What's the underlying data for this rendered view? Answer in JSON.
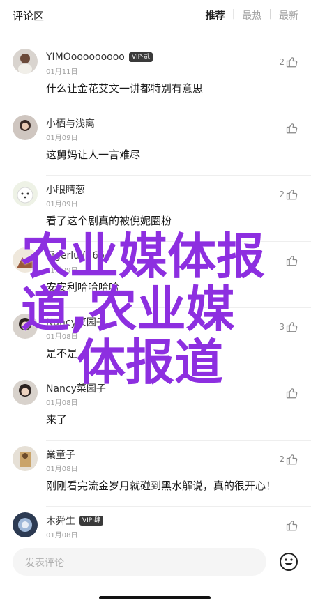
{
  "header": {
    "title": "评论区",
    "tabs": [
      {
        "label": "推荐",
        "active": true
      },
      {
        "label": "最热",
        "active": false
      },
      {
        "label": "最新",
        "active": false
      }
    ]
  },
  "comments": [
    {
      "name": "YIMOooooooooo",
      "badge": "VIP·贰",
      "date": "01月11日",
      "text": "什么让金花艾文一讲都特别有意思",
      "likes": "2"
    },
    {
      "name": "小栖与浅离",
      "badge": "",
      "date": "01月09日",
      "text": "这舅妈让人一言难尽",
      "likes": ""
    },
    {
      "name": "小眼睛葱",
      "badge": "",
      "date": "01月09日",
      "text": "看了这个剧真的被倪妮圈粉",
      "likes": "2"
    },
    {
      "name": "Tigerlul(366",
      "badge": "",
      "date": "01月09日",
      "text": "安安利哈哈哈哈",
      "likes": ""
    },
    {
      "name": "Nancy菜园子",
      "badge": "",
      "date": "01月08日",
      "text": "是不是",
      "likes": "3"
    },
    {
      "name": "Nancy菜园子",
      "badge": "",
      "date": "01月08日",
      "text": "来了",
      "likes": ""
    },
    {
      "name": "業童子",
      "badge": "",
      "date": "01月08日",
      "text": "刚刚看完流金岁月就碰到黑水解说，真的很开心！",
      "likes": "2"
    },
    {
      "name": "木舜生",
      "badge": "VIP·肆",
      "date": "01月08日",
      "text": "",
      "likes": ""
    }
  ],
  "watermark": {
    "line1": "农业媒体报",
    "line2": "道,农业媒",
    "line3": "体报道"
  },
  "input": {
    "placeholder": "发表评论"
  },
  "icons": {
    "like": "thumbs-up-icon",
    "emoji": "smiley-icon"
  },
  "colors": {
    "watermark": "#8d2fe0",
    "accent": "#222222",
    "muted": "#a0a0a0"
  }
}
